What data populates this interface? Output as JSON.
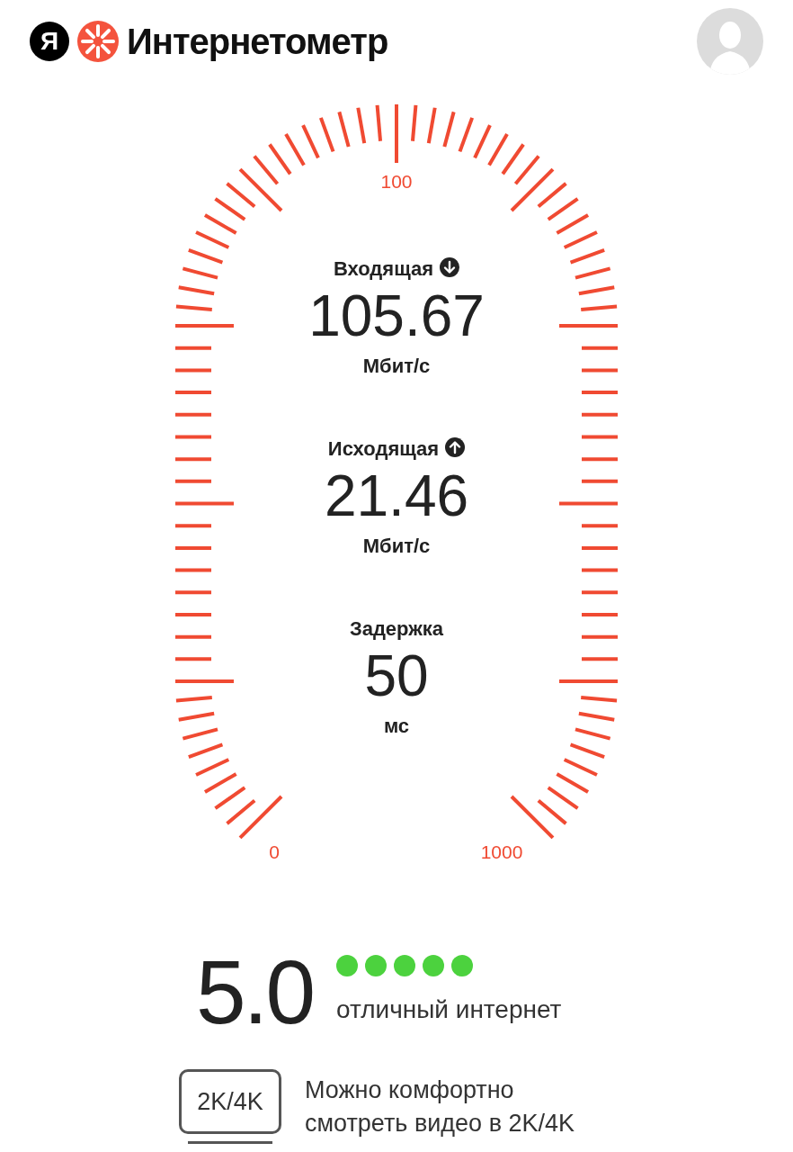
{
  "header": {
    "logo_letter": "Я",
    "title": "Интернетометр"
  },
  "gauge": {
    "scale_labels": [
      "0",
      "100",
      "1000"
    ]
  },
  "metrics": [
    {
      "label": "Входящая",
      "kind": "download",
      "value": "105.67",
      "unit": "Мбит/с"
    },
    {
      "label": "Исходящая",
      "kind": "upload",
      "value": "21.46",
      "unit": "Мбит/с"
    },
    {
      "label": "Задержка",
      "value": "50",
      "unit": "мс"
    }
  ],
  "rating": {
    "score": "5.0",
    "stars": 5,
    "verdict": "отличный интернет"
  },
  "video": {
    "badge": "2K/4K",
    "text": "Можно комфортно\nсмотреть видео в 2K/4K"
  }
}
